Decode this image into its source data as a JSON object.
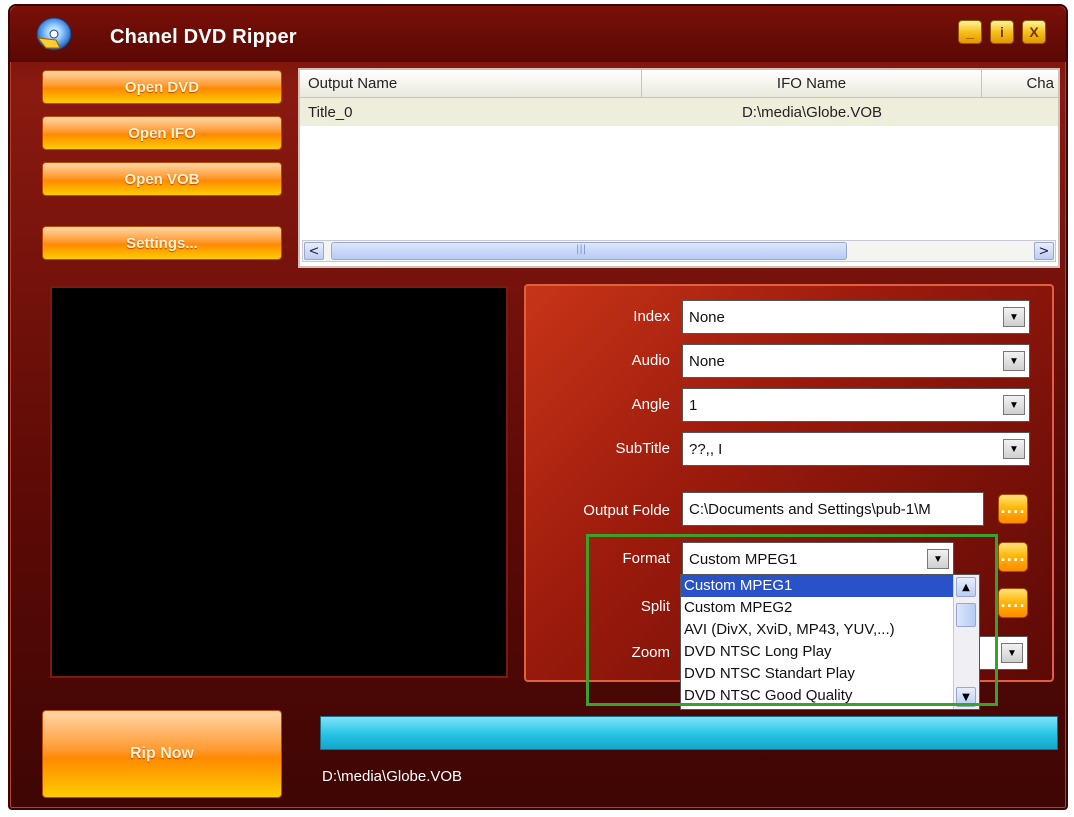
{
  "window": {
    "title": "Chanel DVD Ripper",
    "buttons": {
      "minimize": "_",
      "info": "i",
      "close": "X"
    }
  },
  "left_buttons": {
    "open_dvd": "Open DVD",
    "open_ifo": "Open IFO",
    "open_vob": "Open VOB",
    "settings": "Settings..."
  },
  "title_list": {
    "columns": [
      "Output Name",
      "IFO Name",
      "Cha"
    ],
    "rows": [
      {
        "output_name": "Title_0",
        "ifo_name": "D:\\media\\Globe.VOB",
        "chapter": ""
      }
    ],
    "scroll_left": "<",
    "scroll_right": ">",
    "thumb_grip": "|||"
  },
  "properties": {
    "index_label": "Index",
    "index_value": "None",
    "audio_label": "Audio",
    "audio_value": "None",
    "angle_label": "Angle",
    "angle_value": "1",
    "subtitle_label": "SubTitle",
    "subtitle_value": "??,, I",
    "output_folder_label": "Output Folde",
    "output_folder_value": "C:\\Documents and Settings\\pub-1\\M",
    "format_label": "Format",
    "format_value": "Custom MPEG1",
    "split_label": "Split",
    "zoom_label": "Zoom",
    "browse_button": "...."
  },
  "format_dropdown": {
    "options": [
      "Custom MPEG1",
      "Custom MPEG2",
      "AVI (DivX, XviD, MP43, YUV,...)",
      "DVD NTSC Long Play",
      "DVD NTSC Standart Play",
      "DVD NTSC Good Quality"
    ],
    "selected_index": 0
  },
  "rip": {
    "button": "Rip Now",
    "current_file": "D:\\media\\Globe.VOB"
  },
  "colors": {
    "accent_orange": "#ff9a30",
    "frame_red": "#8a1a10",
    "highlight_green": "#3aa12a",
    "progress_cyan": "#25c3e4"
  }
}
